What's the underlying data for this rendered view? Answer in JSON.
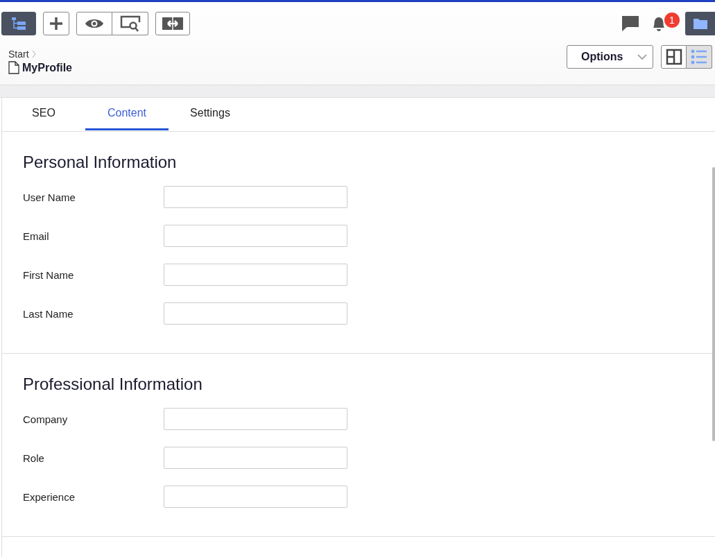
{
  "toolbar": {
    "left": [
      {
        "kind": "tree",
        "active": true
      },
      {
        "kind": "plus",
        "active": false
      },
      {
        "kind": "group",
        "buttons": [
          {
            "kind": "eye",
            "active": false
          },
          {
            "kind": "preview",
            "active": false
          }
        ]
      },
      {
        "kind": "swap",
        "active": false
      }
    ],
    "right": [
      {
        "kind": "comment",
        "active": false
      },
      {
        "kind": "bell",
        "active": false,
        "badge": "1"
      },
      {
        "kind": "folder",
        "active": true
      }
    ]
  },
  "breadcrumb": {
    "parent": "Start",
    "current": "MyProfile"
  },
  "options_button": {
    "label": "Options"
  },
  "view_toggle": [
    {
      "kind": "split",
      "selected": false
    },
    {
      "kind": "list",
      "selected": true
    }
  ],
  "tabs": [
    {
      "label": "SEO",
      "selected": false
    },
    {
      "label": "Content",
      "selected": true
    },
    {
      "label": "Settings",
      "selected": false
    }
  ],
  "sections": [
    {
      "title": "Personal Information",
      "fields": [
        {
          "label": "User Name"
        },
        {
          "label": "Email"
        },
        {
          "label": "First Name"
        },
        {
          "label": "Last Name"
        }
      ]
    },
    {
      "title": "Professional Information",
      "fields": [
        {
          "label": "Company"
        },
        {
          "label": "Role"
        },
        {
          "label": "Experience"
        }
      ]
    }
  ]
}
